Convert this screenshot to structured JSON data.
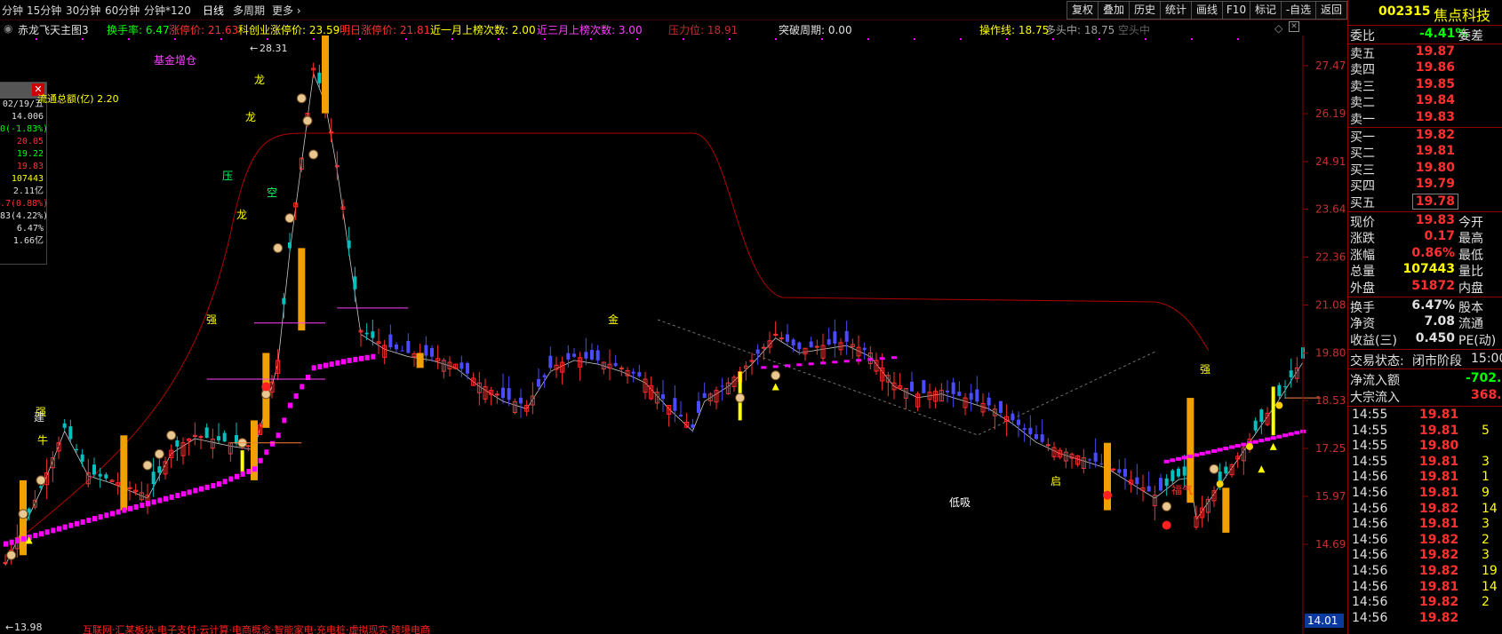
{
  "toolbar": {
    "periods": [
      "分钟",
      "15分钟",
      "30分钟",
      "60分钟",
      "分钟*120",
      "日线",
      "多周期",
      "更多"
    ],
    "active_period": "日线",
    "buttons": [
      "复权",
      "叠加",
      "历史",
      "统计",
      "画线",
      "F10",
      "标记",
      "-自选",
      "返回"
    ]
  },
  "indicator_row": {
    "chart_name": "赤龙飞天主图3",
    "turnover": "换手率: 6.47",
    "limit_up": "涨停价: 21.63",
    "star_limit_up": "科创业涨停价: 23.59",
    "next_limit_up": "明日涨停价: 21.81",
    "month_count": "近一月上榜次数: 2.00",
    "quarter_count": "近三月上榜次数: 3.00",
    "pressure": "压力位: 18.91",
    "breakout": "突破周期: 0.00",
    "op_line": "操作线: 18.75",
    "long_short": "多头中: 18.75",
    "empty_head": "空头中"
  },
  "chart_labels": {
    "fund_add": "基金增仓",
    "high_label": "28.31",
    "low_label": "13.98",
    "bottom_text": "互联网·汇某板块·电子支付·云计算·电商概念·智能家电·充电桩·虚拟现实·跨境电商",
    "dragon": "龙",
    "dragon2": "龙",
    "dragon3": "龙",
    "strong": "强",
    "strong2": "强",
    "strong3": "强",
    "build": "建",
    "kong": "空",
    "ya": "压",
    "jin": "金",
    "bull": "牛",
    "low_suck": "低吸",
    "qi": "启",
    "lucky": "福气"
  },
  "price_axis": [
    "27.47",
    "26.19",
    "24.91",
    "23.64",
    "22.36",
    "21.08",
    "19.80",
    "18.53",
    "17.25",
    "15.97",
    "14.69"
  ],
  "price_axis_current": "14.01",
  "float_box": {
    "title": "流通总额(亿) 2.20",
    "rows": [
      {
        "text": "02/19/五",
        "color": "#e0e0e0"
      },
      {
        "text": "14.006",
        "color": "#e0e0e0"
      },
      {
        "text": "0(-1.83%)",
        "color": "#00ff00"
      },
      {
        "text": "20.05",
        "color": "#ff3030"
      },
      {
        "text": "19.22",
        "color": "#00ff00"
      },
      {
        "text": "19.83",
        "color": "#ff3030"
      },
      {
        "text": "107443",
        "color": "#ffff00"
      },
      {
        "text": "2.11亿",
        "color": "#e0e0e0"
      },
      {
        "text": ".7(0.88%)",
        "color": "#ff3030"
      },
      {
        "text": "83(4.22%)",
        "color": "#e0e0e0"
      },
      {
        "text": "6.47%",
        "color": "#e0e0e0"
      },
      {
        "text": "1.66亿",
        "color": "#e0e0e0"
      }
    ]
  },
  "quote": {
    "code": "002315",
    "name": "焦点科技",
    "ratio_label": "委比",
    "ratio_value": "-4.41%",
    "ratio_tail": "委差",
    "asks": [
      {
        "label": "卖五",
        "price": "19.87"
      },
      {
        "label": "卖四",
        "price": "19.86"
      },
      {
        "label": "卖三",
        "price": "19.85"
      },
      {
        "label": "卖二",
        "price": "19.84"
      },
      {
        "label": "卖一",
        "price": "19.83"
      }
    ],
    "bids": [
      {
        "label": "买一",
        "price": "19.82"
      },
      {
        "label": "买二",
        "price": "19.81"
      },
      {
        "label": "买三",
        "price": "19.80"
      },
      {
        "label": "买四",
        "price": "19.79"
      },
      {
        "label": "买五",
        "price": "19.78"
      }
    ],
    "stats": [
      {
        "l": "现价",
        "v": "19.83",
        "r": "今开",
        "c": "#ff3030"
      },
      {
        "l": "涨跌",
        "v": "0.17",
        "r": "最高",
        "c": "#ff3030"
      },
      {
        "l": "涨幅",
        "v": "0.86%",
        "r": "最低",
        "c": "#ff3030"
      },
      {
        "l": "总量",
        "v": "107443",
        "r": "量比",
        "c": "#ffff00"
      },
      {
        "l": "外盘",
        "v": "51872",
        "r": "内盘",
        "c": "#ff3030"
      }
    ],
    "stats2": [
      {
        "l": "换手",
        "v": "6.47%",
        "r": "股本",
        "c": "#e0e0e0"
      },
      {
        "l": "净资",
        "v": "7.08",
        "r": "流通",
        "c": "#e0e0e0"
      },
      {
        "l": "收益(三)",
        "v": "0.450",
        "r": "PE(动)",
        "c": "#e0e0e0"
      }
    ],
    "trade_state_label": "交易状态:",
    "trade_state_value": "闭市阶段",
    "trade_time": "15:00",
    "net_inflow_label": "净流入额",
    "net_inflow_value": "-702.",
    "block_label": "大宗流入",
    "block_value": "368.",
    "ticks": [
      {
        "t": "14:55",
        "p": "19.81",
        "v": "",
        "c": "#ff3030"
      },
      {
        "t": "14:55",
        "p": "19.81",
        "v": "5",
        "c": "#ff3030"
      },
      {
        "t": "14:55",
        "p": "19.80",
        "v": "",
        "c": "#ff3030"
      },
      {
        "t": "14:55",
        "p": "19.81",
        "v": "3",
        "c": "#ff3030"
      },
      {
        "t": "14:56",
        "p": "19.81",
        "v": "1",
        "c": "#ff3030"
      },
      {
        "t": "14:56",
        "p": "19.81",
        "v": "9",
        "c": "#ff3030"
      },
      {
        "t": "14:56",
        "p": "19.82",
        "v": "14",
        "c": "#ff3030"
      },
      {
        "t": "14:56",
        "p": "19.81",
        "v": "3",
        "c": "#ff3030"
      },
      {
        "t": "14:56",
        "p": "19.82",
        "v": "2",
        "c": "#ff3030"
      },
      {
        "t": "14:56",
        "p": "19.82",
        "v": "3",
        "c": "#ff3030"
      },
      {
        "t": "14:56",
        "p": "19.82",
        "v": "19",
        "c": "#ff3030"
      },
      {
        "t": "14:56",
        "p": "19.81",
        "v": "14",
        "c": "#ff3030"
      },
      {
        "t": "14:56",
        "p": "19.82",
        "v": "2",
        "c": "#ff3030"
      },
      {
        "t": "14:56",
        "p": "19.82",
        "v": "",
        "c": "#ff3030"
      }
    ]
  }
}
